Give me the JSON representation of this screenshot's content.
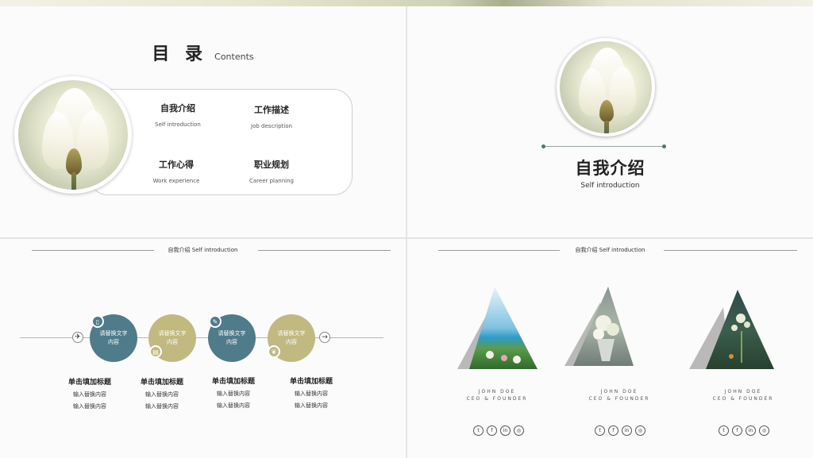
{
  "toc": {
    "title": "目 录",
    "title_en": "Contents",
    "items": [
      {
        "cn": "自我介绍",
        "en": "Self introduction"
      },
      {
        "cn": "工作描述",
        "en": "Job description"
      },
      {
        "cn": "工作心得",
        "en": "Work experience"
      },
      {
        "cn": "职业规划",
        "en": "Career  planning"
      }
    ]
  },
  "section": {
    "title": "自我介绍",
    "subtitle": "Self introduction",
    "header": "自我介绍  Self introduction"
  },
  "timeline": {
    "circles": [
      {
        "text": "请替换文字内容",
        "color": "#4f7b8b"
      },
      {
        "text": "请替换文字内容",
        "color": "#c1b97f"
      },
      {
        "text": "请替换文字内容",
        "color": "#4f7b8b"
      },
      {
        "text": "请替换文字内容",
        "color": "#c1b97f"
      }
    ],
    "steps": [
      {
        "heading": "单击填加标题",
        "line1": "输入替换内容",
        "line2": "输入替换内容"
      },
      {
        "heading": "单击填加标题",
        "line1": "输入替换内容",
        "line2": "输入替换内容"
      },
      {
        "heading": "单击填加标题",
        "line1": "输入替换内容",
        "line2": "输入替换内容"
      },
      {
        "heading": "单击填加标题",
        "line1": "输入替换内容",
        "line2": "输入替换内容"
      }
    ],
    "badge_icons": [
      "clipboard-icon",
      "document-icon",
      "pencil-icon",
      "leaf-icon"
    ]
  },
  "team": {
    "members": [
      {
        "name": "JOHN DOE",
        "role": "CEO & FOUNDER",
        "photo": "beach-photo"
      },
      {
        "name": "JOHN DOE",
        "role": "CEO & FOUNDER",
        "photo": "bouquet-photo"
      },
      {
        "name": "JOHN DOE",
        "role": "CEO & FOUNDER",
        "photo": "plant-photo"
      }
    ],
    "social_icons": [
      "twitter-icon",
      "facebook-icon",
      "linkedin-icon",
      "instagram-icon"
    ]
  },
  "colors": {
    "accent_blue": "#4f7b8b",
    "accent_olive": "#c1b97f",
    "accent_green": "#4e7a6a"
  }
}
